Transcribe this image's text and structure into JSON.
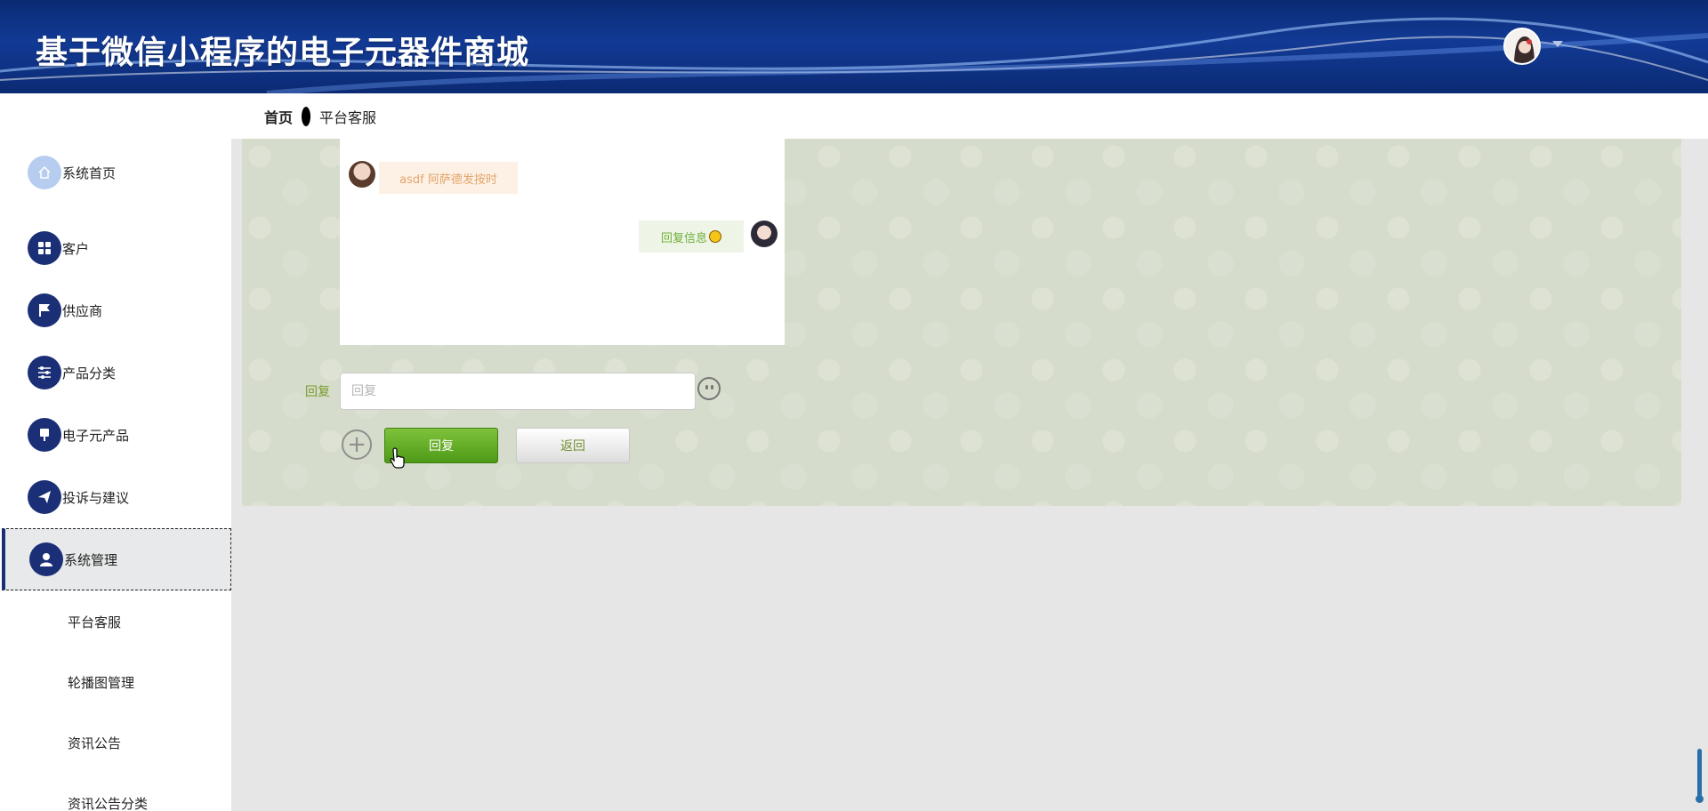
{
  "header": {
    "title": "基于微信小程序的电子元器件商城"
  },
  "breadcrumb": {
    "home": "首页",
    "current": "平台客服"
  },
  "sidebar": {
    "items": [
      {
        "label": "系统首页",
        "icon": "home-icon"
      },
      {
        "label": "客户",
        "icon": "grid-icon"
      },
      {
        "label": "供应商",
        "icon": "flag-icon"
      },
      {
        "label": "产品分类",
        "icon": "sliders-icon"
      },
      {
        "label": "电子元产品",
        "icon": "component-icon"
      },
      {
        "label": "投诉与建议",
        "icon": "send-icon"
      },
      {
        "label": "系统管理",
        "icon": "user-icon",
        "active": true
      }
    ],
    "sub_items": [
      {
        "label": "平台客服"
      },
      {
        "label": "轮播图管理"
      },
      {
        "label": "资讯公告"
      },
      {
        "label": "资讯公告分类"
      }
    ]
  },
  "chat": {
    "messages": [
      {
        "side": "left",
        "text": "asdf 阿萨德发按时"
      },
      {
        "side": "right",
        "text": "回复信息"
      }
    ]
  },
  "form": {
    "reply_label": "回复",
    "reply_placeholder": "回复",
    "reply_value": "",
    "submit_label": "回复",
    "back_label": "返回"
  },
  "colors": {
    "header_bg": "#123a95",
    "sidebar_icon": "#1b2f77",
    "panel_bg": "#d5dccb",
    "primary_button": "#4e9a17"
  }
}
